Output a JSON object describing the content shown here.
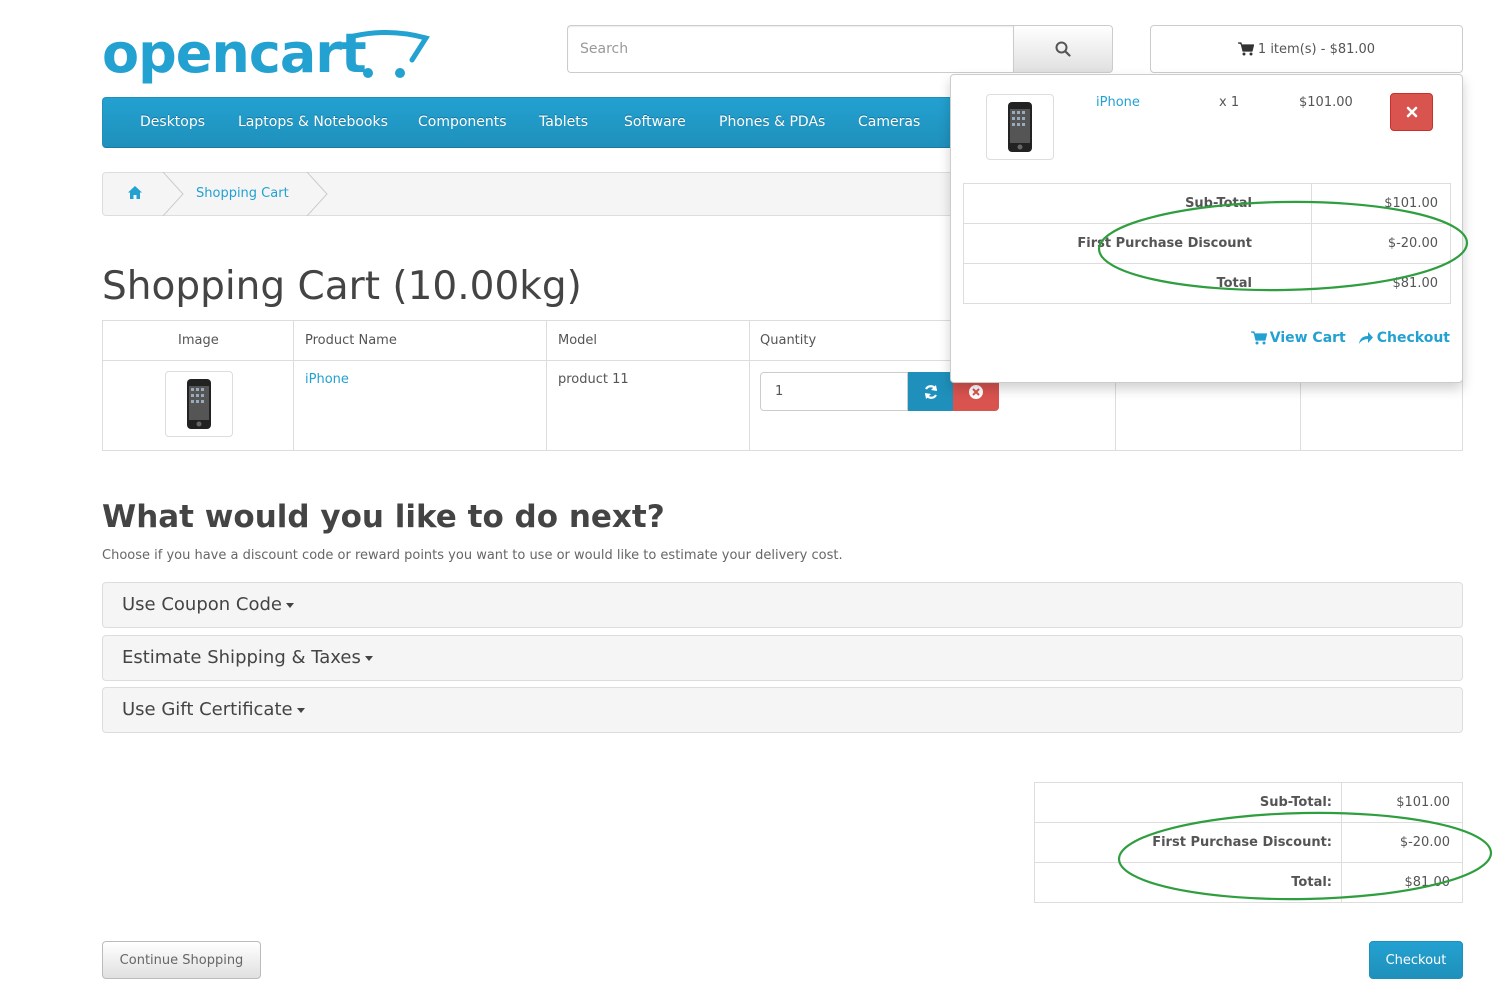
{
  "header": {
    "logo_text": "opencart",
    "search": {
      "placeholder": "Search",
      "value": ""
    },
    "cart_summary": "1 item(s) - $81.00"
  },
  "menu": {
    "items": [
      "Desktops",
      "Laptops & Notebooks",
      "Components",
      "Tablets",
      "Software",
      "Phones & PDAs",
      "Cameras"
    ]
  },
  "breadcrumb": {
    "current": "Shopping Cart"
  },
  "page_title": "Shopping Cart  (10.00kg)",
  "cart_table": {
    "headers": {
      "image": "Image",
      "name": "Product Name",
      "model": "Model",
      "quantity": "Quantity"
    },
    "rows": [
      {
        "name": "iPhone",
        "model": "product 11",
        "quantity": "1"
      }
    ]
  },
  "next": {
    "title": "What would you like to do next?",
    "description": "Choose if you have a discount code or reward points you want to use or would like to estimate your delivery cost.",
    "panels": [
      "Use Coupon Code",
      "Estimate Shipping & Taxes",
      "Use Gift Certificate"
    ]
  },
  "totals": {
    "rows": [
      {
        "label": "Sub-Total:",
        "value": "$101.00"
      },
      {
        "label": "First Purchase Discount:",
        "value": "$-20.00"
      },
      {
        "label": "Total:",
        "value": "$81.00"
      }
    ]
  },
  "buttons": {
    "continue": "Continue Shopping",
    "checkout": "Checkout"
  },
  "dropdown": {
    "item": {
      "name": "iPhone",
      "qty": "x 1",
      "price": "$101.00"
    },
    "totals": [
      {
        "label": "Sub-Total",
        "value": "$101.00"
      },
      {
        "label": "First Purchase Discount",
        "value": "$-20.00"
      },
      {
        "label": "Total",
        "value": "$81.00"
      }
    ],
    "view_cart": "View Cart",
    "checkout": "Checkout"
  },
  "colors": {
    "accent": "#23a1d1",
    "danger": "#d9534f",
    "annotation": "#2e9e3e"
  }
}
